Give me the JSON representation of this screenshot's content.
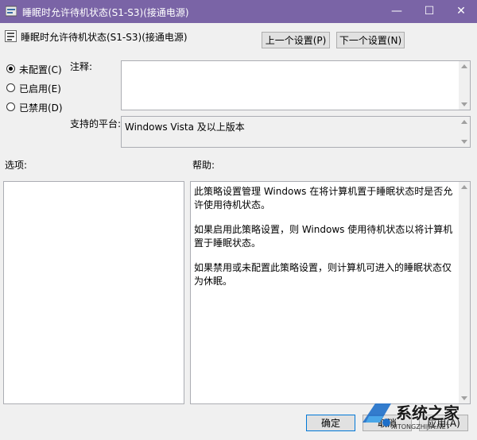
{
  "window": {
    "title": "睡眠时允许待机状态(S1-S3)(接通电源)",
    "minimize": "—",
    "maximize": "☐",
    "close": "✕"
  },
  "header": {
    "policy_title": "睡眠时允许待机状态(S1-S3)(接通电源)",
    "prev_button": "上一个设置(P)",
    "next_button": "下一个设置(N)"
  },
  "state_options": [
    {
      "label": "未配置(C)",
      "selected": true
    },
    {
      "label": "已启用(E)",
      "selected": false
    },
    {
      "label": "已禁用(D)",
      "selected": false
    }
  ],
  "comment": {
    "label": "注释:",
    "value": ""
  },
  "platform": {
    "label": "支持的平台:",
    "value": "Windows Vista 及以上版本"
  },
  "options": {
    "label": "选项:"
  },
  "help": {
    "label": "帮助:",
    "paragraphs": [
      "此策略设置管理 Windows 在将计算机置于睡眠状态时是否允许使用待机状态。",
      "如果启用此策略设置，则 Windows 使用待机状态以将计算机置于睡眠状态。",
      "如果禁用或未配置此策略设置，则计算机可进入的睡眠状态仅为休眠。"
    ]
  },
  "footer": {
    "ok": "确定",
    "cancel": "取消",
    "apply": "应用(A)"
  },
  "watermark": {
    "text": "系统之家",
    "sub": "XITONGZHIJIA.NET"
  }
}
